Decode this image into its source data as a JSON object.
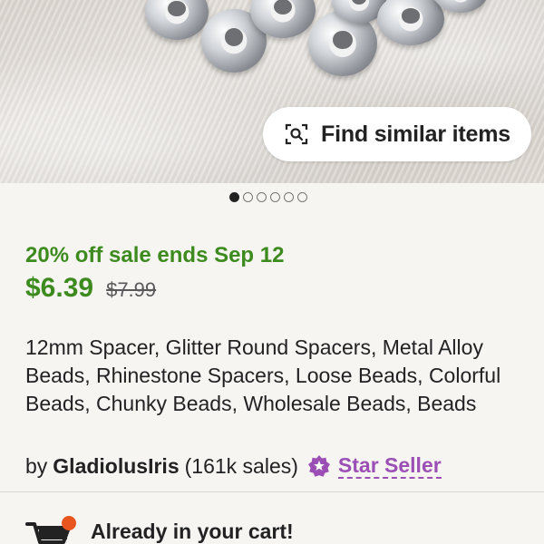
{
  "image": {
    "alt": ""
  },
  "find_similar": {
    "label": "Find similar items",
    "icon": "image-search-icon"
  },
  "carousel": {
    "count": 6,
    "active": 0
  },
  "sale": {
    "text": "20% off sale ends Sep 12",
    "color": "#3d8b1e"
  },
  "price": {
    "current": "$6.39",
    "original": "$7.99"
  },
  "listing": {
    "title": "12mm Spacer, Glitter Round Spacers, Metal Alloy Beads, Rhinestone Spacers, Loose Beads, Colorful Beads, Chunky Beads, Wholesale Beads, Beads"
  },
  "seller": {
    "by": "by",
    "shop": "GladiolusIris",
    "sales": "(161k sales)",
    "badge": "Star Seller",
    "badge_color": "#9b4fb5",
    "badge_icon": "star-seller-icon"
  },
  "cart": {
    "text": "Already in your cart!",
    "icon": "shopping-cart-icon",
    "dot_color": "#e8551f"
  }
}
